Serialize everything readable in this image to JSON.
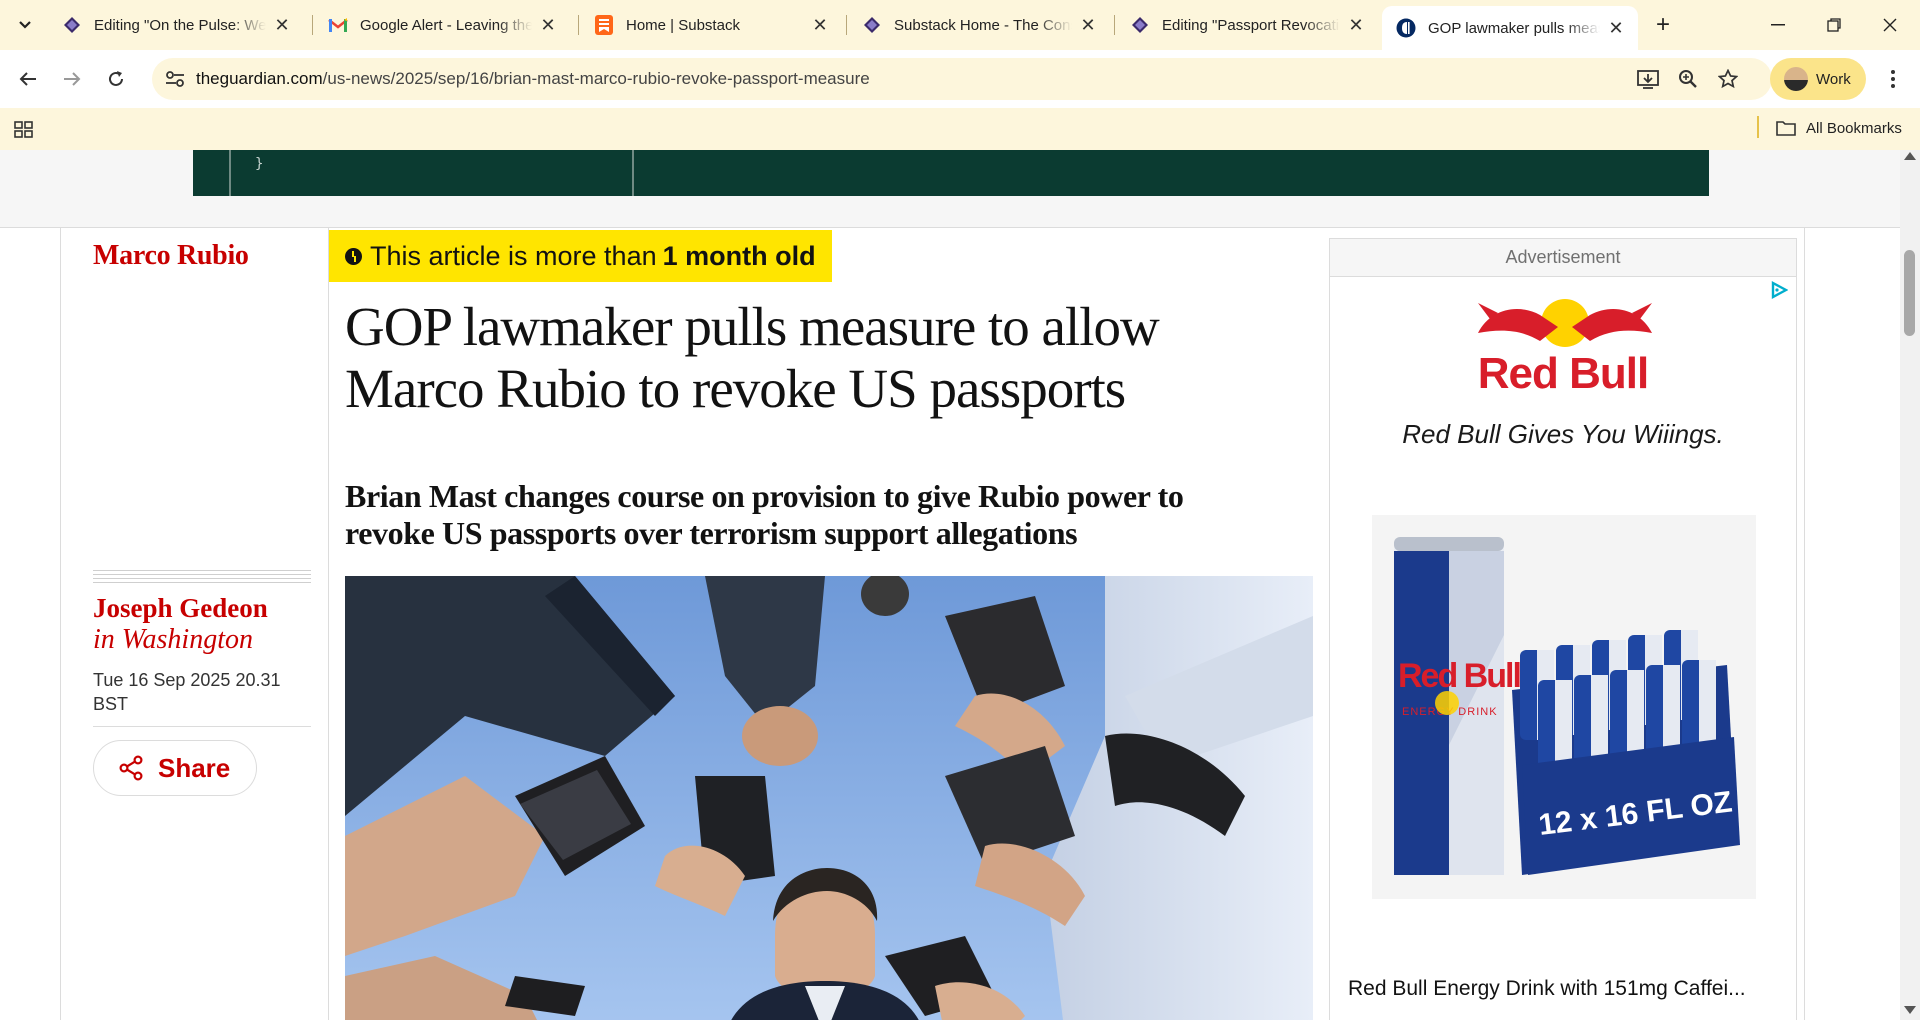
{
  "browser": {
    "tabs": [
      {
        "title": "Editing \"On the Pulse: Wee",
        "favicon": "substack-editor-icon"
      },
      {
        "title": "Google Alert - Leaving the",
        "favicon": "gmail-icon"
      },
      {
        "title": "Home | Substack",
        "favicon": "substack-icon"
      },
      {
        "title": "Substack Home - The Cons",
        "favicon": "substack-editor-icon"
      },
      {
        "title": "Editing \"Passport Revocatio",
        "favicon": "substack-editor-icon"
      },
      {
        "title": "GOP lawmaker pulls meas",
        "favicon": "guardian-icon",
        "active": true
      }
    ],
    "url_host": "theguardian.com",
    "url_path": "/us-news/2025/sep/16/brian-mast-marco-rubio-revoke-passport-measure",
    "profile_label": "Work",
    "all_bookmarks_label": "All Bookmarks",
    "colors": {
      "tabbar": "#fdf6dc",
      "profile": "#fbe48a"
    }
  },
  "article": {
    "section": "Marco Rubio",
    "age_prefix": "This article is more than",
    "age_value": "1 month old",
    "headline": "GOP lawmaker pulls measure to allow Marco Rubio to revoke US passports",
    "standfirst": "Brian Mast changes course on provision to give Rubio power to revoke US passports over terrorism support allegations",
    "author": "Joseph Gedeon",
    "author_location": "in Washington",
    "dateline": "Tue 16 Sep 2025 20.31 BST",
    "share_label": "Share",
    "colors": {
      "accent": "#c70000",
      "badge": "#ffe500",
      "text": "#121212"
    }
  },
  "ad": {
    "label": "Advertisement",
    "brand": "Red Bull",
    "tagline": "Red Bull Gives You Wiiings.",
    "product_title": "Red Bull Energy Drink with 151mg Caffei...",
    "can_brand": "Red Bull",
    "can_subtitle": "ENERGY DRINK",
    "pack_label": "12 x 16 FL OZ",
    "colors": {
      "brand_red": "#d81e2a",
      "brand_navy": "#1b3a8c",
      "brand_yellow": "#ffd200"
    }
  }
}
